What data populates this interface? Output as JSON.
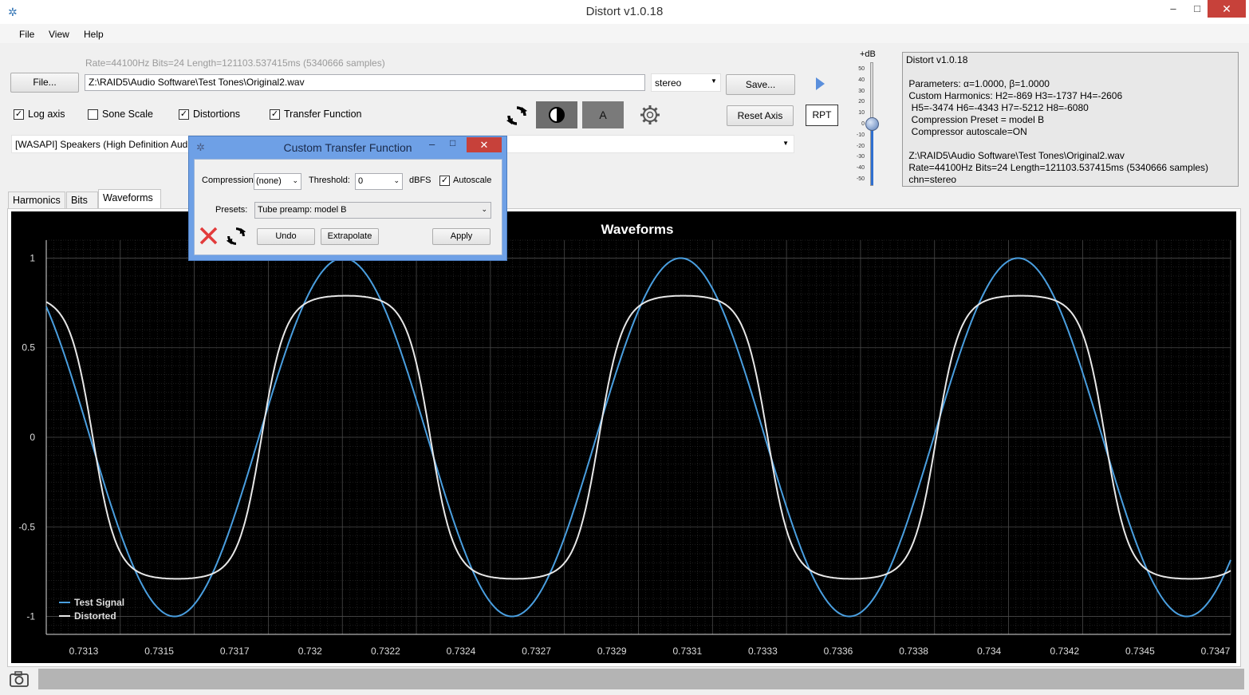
{
  "window": {
    "title": "Distort v1.0.18",
    "minimize": "–",
    "maximize": "□",
    "close": "✕"
  },
  "menu": [
    "File",
    "View",
    "Help"
  ],
  "file_info": "Rate=44100Hz Bits=24 Length=121103.537415ms (5340666 samples)",
  "file_button": "File...",
  "file_path": "Z:\\RAID5\\Audio Software\\Test Tones\\Original2.wav",
  "channel_select": "stereo",
  "save_button": "Save...",
  "reset_axis_button": "Reset Axis",
  "rpt_button": "RPT",
  "a_button": "A",
  "checkboxes": [
    {
      "label": "Log axis",
      "checked": true
    },
    {
      "label": "Sone Scale",
      "checked": false
    },
    {
      "label": "Distortions",
      "checked": true
    },
    {
      "label": "Transfer Function",
      "checked": true
    }
  ],
  "output_device": "[WASAPI] Speakers (High Definition Aud",
  "volume": {
    "label": "+dB",
    "ticks": [
      "50",
      "40",
      "30",
      "20",
      "10",
      "0",
      "-10",
      "-20",
      "-30",
      "-40",
      "-50"
    ],
    "value_db": 0
  },
  "info_text": "Distort v1.0.18\n\n Parameters: α=1.0000, β=1.0000\n Custom Harmonics: H2=-869 H3=-1737 H4=-2606\n  H5=-3474 H6=-4343 H7=-5212 H8=-6080\n  Compression Preset = model B\n  Compressor autoscale=ON\n\n Z:\\RAID5\\Audio Software\\Test Tones\\Original2.wav\n Rate=44100Hz Bits=24 Length=121103.537415ms (5340666 samples)\n chn=stereo",
  "tabs": [
    "Harmonics",
    "Bits",
    "Waveforms"
  ],
  "dialog": {
    "title": "Custom Transfer Function",
    "compression_label": "Compression:",
    "compression_value": "(none)",
    "threshold_label": "Threshold:",
    "threshold_value": "0",
    "dbfs_label": "dBFS",
    "autoscale_label": "Autoscale",
    "autoscale_checked": true,
    "presets_label": "Presets:",
    "presets_value": "Tube preamp: model B",
    "undo_button": "Undo",
    "extrapolate_button": "Extrapolate",
    "apply_button": "Apply"
  },
  "colors": {
    "test_signal": "#4a9fe0",
    "distorted": "#e8e8e8",
    "chart_bg": "#000000",
    "grid": "#3a3a3a"
  },
  "chart_data": {
    "type": "line",
    "title": "Waveforms",
    "xlabel": "",
    "ylabel": "",
    "xlim": [
      0.73122,
      0.73473
    ],
    "ylim": [
      -1.1,
      1.1
    ],
    "x_ticks": [
      "0.7313",
      "0.7315",
      "0.7317",
      "0.732",
      "0.7322",
      "0.7324",
      "0.7327",
      "0.7329",
      "0.7331",
      "0.7333",
      "0.7336",
      "0.7338",
      "0.734",
      "0.7342",
      "0.7345",
      "0.7347"
    ],
    "y_ticks": [
      "1",
      "0.5",
      "0",
      "-0.5",
      "-1"
    ],
    "legend_position": "bottom-left",
    "series": [
      {
        "name": "Test Signal",
        "frequency_hz": 1000,
        "amplitude": 1.0,
        "peak_x": 0.7321,
        "x_range": [
          0.73122,
          0.73473
        ]
      },
      {
        "name": "Distorted",
        "frequency_hz": 1000,
        "clip_level": 0.79,
        "peak_x": 0.7321,
        "x_range": [
          0.73122,
          0.73473
        ]
      }
    ]
  }
}
